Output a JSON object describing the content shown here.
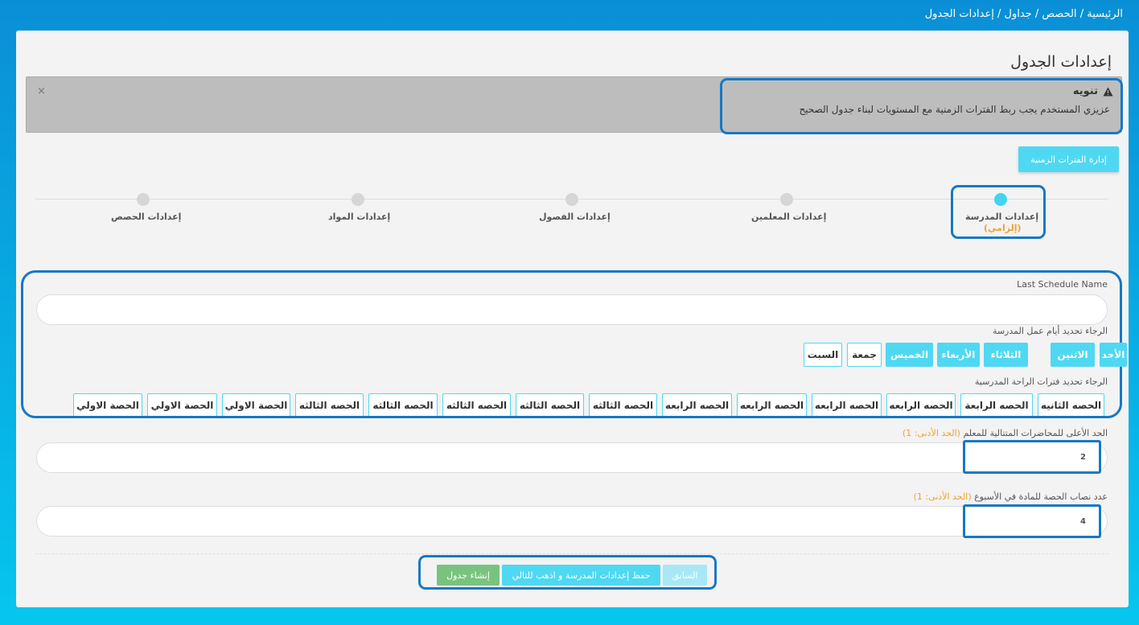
{
  "breadcrumb": {
    "home": "الرئيسية",
    "sep": "/",
    "classes": "الحصص",
    "schedules": "جداول",
    "current": "إعدادات الجدول"
  },
  "page": {
    "title": "إعدادات الجدول"
  },
  "alert": {
    "title": "تنويه",
    "message": "عزيزي المستخدم يجب ربط الفترات الزمنية مع المستويات لبناء جدول الصحيح",
    "close": "×",
    "warning_icon": "warning-triangle-icon"
  },
  "manage_button": "إدارة الفترات الزمنية",
  "steps": [
    {
      "label": "إعدادات المدرسة",
      "required": "(إلزامي)",
      "active": true
    },
    {
      "label": "إعدادات المعلمين",
      "required": "",
      "active": false
    },
    {
      "label": "إعدادات الفصول",
      "required": "",
      "active": false
    },
    {
      "label": "إعدادات المواد",
      "required": "",
      "active": false
    },
    {
      "label": "إعدادات الحصص",
      "required": "",
      "active": false
    }
  ],
  "form": {
    "schedule_name_label": "Last Schedule Name",
    "schedule_name_value": "",
    "workdays_label": "الرجاء تحديد أيام عمل المدرسة",
    "days": [
      {
        "label": "الأحد",
        "selected": true
      },
      {
        "label": "الاثنين",
        "selected": true
      },
      {
        "label": "الثلاثاء",
        "selected": true
      },
      {
        "label": "الأربعاء",
        "selected": true
      },
      {
        "label": "الخميس",
        "selected": true
      },
      {
        "label": "جمعة",
        "selected": false
      },
      {
        "label": "السبت",
        "selected": false
      }
    ],
    "breaks_label": "الرجاء تحديد فترات الراحة المدرسية",
    "periods": [
      "الحصه الثانيه",
      "الحصه الرابعة",
      "الحصه الرابعه",
      "الحصه الرابعه",
      "الحصه الرابعه",
      "الحصه الرابعه",
      "الحصه الثالثه",
      "الحصه الثالثه",
      "الحصه الثالثه",
      "الحصه الثالثه",
      "الحصه الثالثه",
      "الحصة الاولي",
      "الحصة الاولي",
      "الحصة الاولي"
    ],
    "max_consecutive_label": "الحد الأعلى للمحاضرات المتتالية للمعلم",
    "max_consecutive_hint": "(الحد الأدنى: 1)",
    "max_consecutive_value": "2",
    "weekly_quota_label": "عدد نصاب الحصة للمادة في الأسبوع",
    "weekly_quota_hint": "(الحد الأدنى: 1)",
    "weekly_quota_value": "4"
  },
  "buttons": {
    "previous": "السابق",
    "save_next": "حفظ إعدادات المدرسة و اذهب للتالي",
    "create": "إنشاء جدول"
  }
}
